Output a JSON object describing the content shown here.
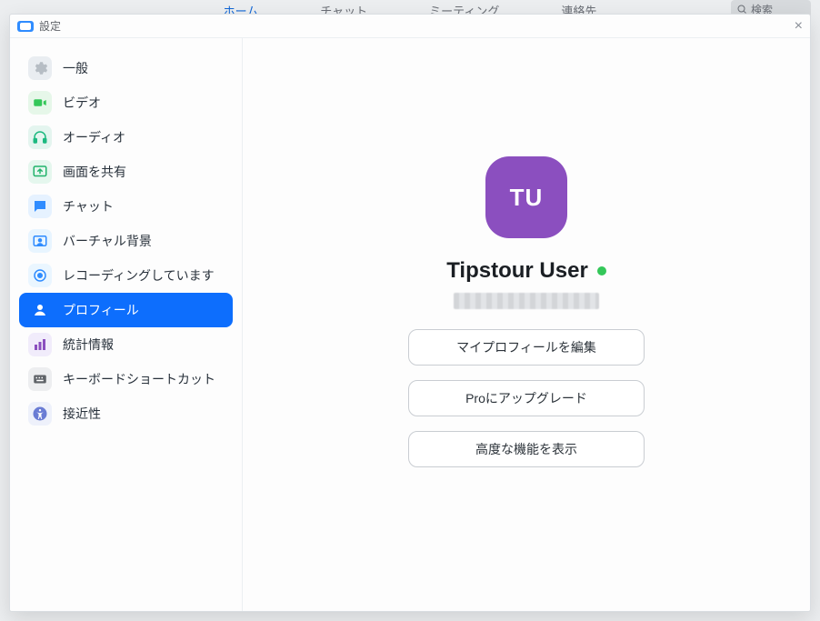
{
  "background": {
    "tabs": {
      "home": "ホーム",
      "chat": "チャット",
      "meetings": "ミーティング",
      "contacts": "連絡先"
    },
    "search_placeholder": "検索"
  },
  "titlebar": {
    "title": "設定"
  },
  "sidebar": {
    "items": [
      {
        "key": "general",
        "label": "一般"
      },
      {
        "key": "video",
        "label": "ビデオ"
      },
      {
        "key": "audio",
        "label": "オーディオ"
      },
      {
        "key": "share",
        "label": "画面を共有"
      },
      {
        "key": "chat",
        "label": "チャット"
      },
      {
        "key": "vbg",
        "label": "バーチャル背景"
      },
      {
        "key": "rec",
        "label": "レコーディングしています"
      },
      {
        "key": "profile",
        "label": "プロフィール"
      },
      {
        "key": "stats",
        "label": "統計情報"
      },
      {
        "key": "keyboard",
        "label": "キーボードショートカット"
      },
      {
        "key": "access",
        "label": "接近性"
      }
    ],
    "active_key": "profile"
  },
  "profile": {
    "avatar_initials": "TU",
    "display_name": "Tipstour User",
    "buttons": {
      "edit": "マイプロフィールを編集",
      "upgrade": "Proにアップグレード",
      "advanced": "高度な機能を表示"
    }
  }
}
